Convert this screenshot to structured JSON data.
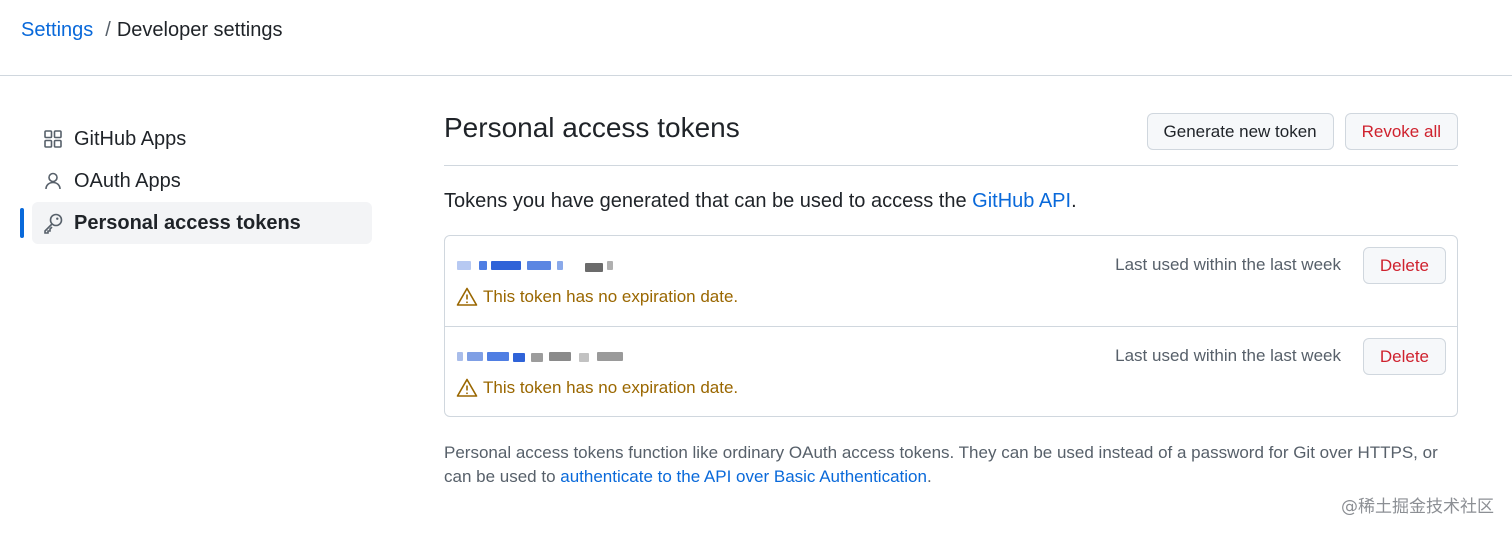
{
  "breadcrumb": {
    "root": "Settings",
    "separator": "/",
    "current": "Developer settings"
  },
  "sidebar": {
    "items": [
      {
        "label": "GitHub Apps",
        "icon": "apps-grid-icon",
        "active": false
      },
      {
        "label": "OAuth Apps",
        "icon": "person-icon",
        "active": false
      },
      {
        "label": "Personal access tokens",
        "icon": "key-icon",
        "active": true
      }
    ]
  },
  "main": {
    "title": "Personal access tokens",
    "generate_button": "Generate new token",
    "revoke_button": "Revoke all",
    "intro_prefix": "Tokens you have generated that can be used to access the ",
    "intro_link": "GitHub API",
    "intro_suffix": ".",
    "tokens": [
      {
        "last_used": "Last used within the last week",
        "delete_label": "Delete",
        "warning": "This token has no expiration date."
      },
      {
        "last_used": "Last used within the last week",
        "delete_label": "Delete",
        "warning": "This token has no expiration date."
      }
    ],
    "footnote_prefix": "Personal access tokens function like ordinary OAuth access tokens. They can be used instead of a password for Git over HTTPS, or can be used to ",
    "footnote_link": "authenticate to the API over Basic Authentication",
    "footnote_suffix": "."
  },
  "watermark": "@稀土掘金技术社区",
  "colors": {
    "link": "#0969da",
    "danger": "#cf222e",
    "warning": "#9a6700",
    "border": "#d0d7de"
  }
}
